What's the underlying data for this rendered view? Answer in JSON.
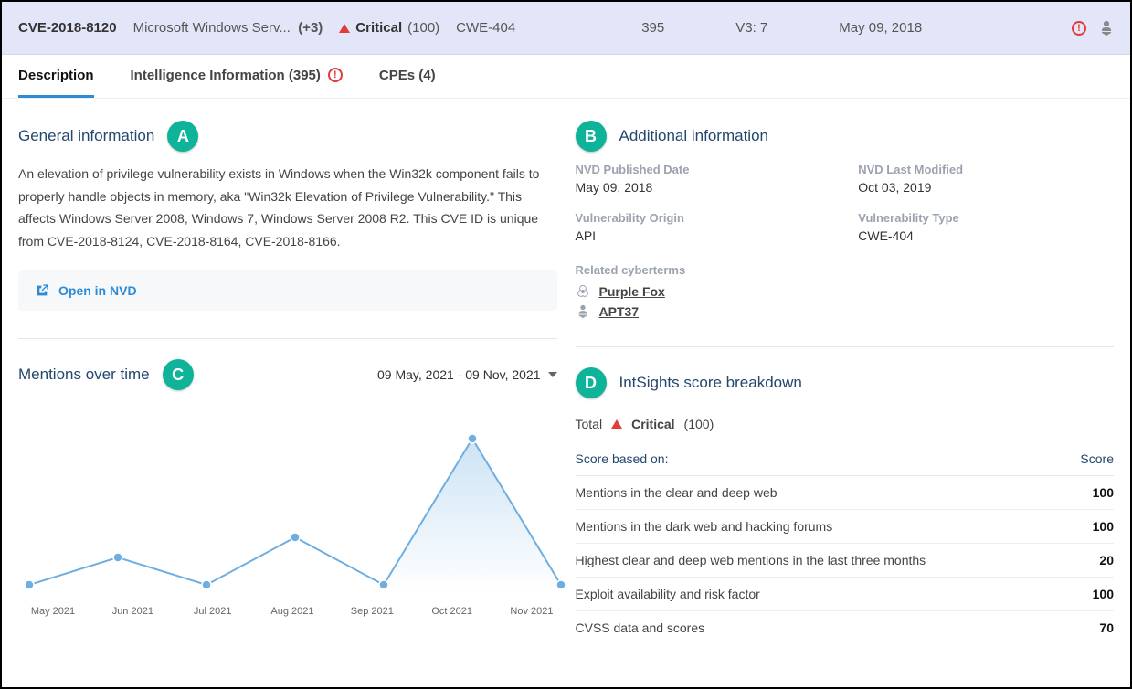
{
  "header": {
    "cve_id": "CVE-2018-8120",
    "affected": "Microsoft Windows Serv...",
    "affected_more": "(+3)",
    "severity_label": "Critical",
    "severity_score": "(100)",
    "cwe": "CWE-404",
    "count": "395",
    "cvss": "V3: 7",
    "date": "May 09, 2018"
  },
  "tabs": {
    "description": "Description",
    "intel": "Intelligence Information (395)",
    "cpes": "CPEs (4)"
  },
  "badges": {
    "a": "A",
    "b": "B",
    "c": "C",
    "d": "D"
  },
  "general": {
    "title": "General information",
    "text": "An elevation of privilege vulnerability exists in Windows when the Win32k component fails to properly handle objects in memory, aka \"Win32k Elevation of Privilege Vulnerability.\" This affects Windows Server 2008, Windows 7, Windows Server 2008 R2. This CVE ID is unique from CVE-2018-8124, CVE-2018-8164, CVE-2018-8166.",
    "open_nvd": "Open in NVD"
  },
  "additional": {
    "title": "Additional information",
    "published_label": "NVD Published Date",
    "published_value": "May 09, 2018",
    "modified_label": "NVD Last Modified",
    "modified_value": "Oct 03, 2019",
    "origin_label": "Vulnerability Origin",
    "origin_value": "API",
    "type_label": "Vulnerability Type",
    "type_value": "CWE-404",
    "cyber_label": "Related cyberterms",
    "cyber_items": {
      "0": "Purple Fox",
      "1": "APT37"
    }
  },
  "mentions": {
    "title": "Mentions over time",
    "range": "09 May, 2021 - 09 Nov, 2021"
  },
  "breakdown": {
    "title": "IntSights score breakdown",
    "total_label": "Total",
    "total_sev": "Critical",
    "total_score": "(100)",
    "head_left": "Score based on:",
    "head_right": "Score",
    "rows": {
      "0": {
        "label": "Mentions in the clear and deep web",
        "value": "100"
      },
      "1": {
        "label": "Mentions in the dark web and hacking forums",
        "value": "100"
      },
      "2": {
        "label": "Highest clear and deep web mentions in the last three months",
        "value": "20"
      },
      "3": {
        "label": "Exploit availability and risk factor",
        "value": "100"
      },
      "4": {
        "label": "CVSS data and scores",
        "value": "70"
      }
    }
  },
  "chart_data": {
    "type": "line",
    "title": "Mentions over time",
    "xlabel": "",
    "ylabel": "",
    "categories": [
      "May 2021",
      "Jun 2021",
      "Jul 2021",
      "Aug 2021",
      "Sep 2021",
      "Oct 2021",
      "Nov 2021"
    ],
    "values": [
      2,
      15,
      2,
      25,
      2,
      70,
      2
    ],
    "ylim": [
      0,
      80
    ]
  }
}
